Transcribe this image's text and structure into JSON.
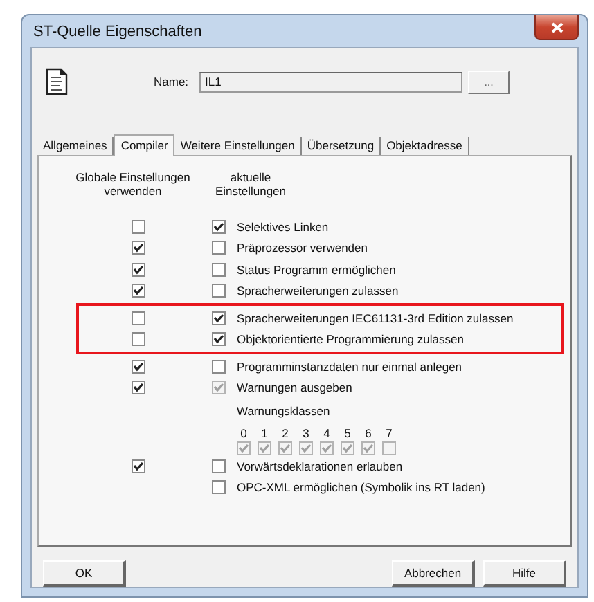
{
  "window": {
    "title": "ST-Quelle Eigenschaften"
  },
  "name_field": {
    "label": "Name:",
    "value": "IL1"
  },
  "browse_button": "...",
  "tabs": [
    {
      "label": "Allgemeines",
      "selected": false
    },
    {
      "label": "Compiler",
      "selected": true
    },
    {
      "label": "Weitere Einstellungen",
      "selected": false
    },
    {
      "label": "Übersetzung",
      "selected": false
    },
    {
      "label": "Objektadresse",
      "selected": false
    }
  ],
  "column_headers": {
    "global": "Globale Einstellungen verwenden",
    "current": "aktuelle Einstellungen"
  },
  "options": [
    {
      "kind": "option",
      "label": "Selektives Linken",
      "global": {
        "checked": false
      },
      "current": {
        "checked": true,
        "disabled": false
      },
      "highlighted": false
    },
    {
      "kind": "option",
      "label": "Präprozessor verwenden",
      "global": {
        "checked": true
      },
      "current": {
        "checked": false,
        "disabled": false
      },
      "highlighted": false
    },
    {
      "kind": "option",
      "label": "Status Programm ermöglichen",
      "global": {
        "checked": true
      },
      "current": {
        "checked": false,
        "disabled": false
      },
      "highlighted": false
    },
    {
      "kind": "option",
      "label": "Spracherweiterungen zulassen",
      "global": {
        "checked": true
      },
      "current": {
        "checked": false,
        "disabled": false
      },
      "highlighted": false
    },
    {
      "kind": "option",
      "label": "Spracherweiterungen IEC61131-3rd Edition zulassen",
      "global": {
        "checked": false
      },
      "current": {
        "checked": true,
        "disabled": false
      },
      "highlighted": true
    },
    {
      "kind": "option",
      "label": "Objektorientierte Programmierung zulassen",
      "global": {
        "checked": false
      },
      "current": {
        "checked": true,
        "disabled": false
      },
      "highlighted": true
    },
    {
      "kind": "option",
      "label": "Programminstanzdaten nur einmal anlegen",
      "global": {
        "checked": true
      },
      "current": {
        "checked": false,
        "disabled": false
      },
      "highlighted": false
    },
    {
      "kind": "option",
      "label": "Warnungen ausgeben",
      "global": {
        "checked": true
      },
      "current": {
        "checked": true,
        "disabled": true
      },
      "highlighted": false
    },
    {
      "kind": "warning_classes",
      "label": "Warnungsklassen",
      "classes": [
        {
          "label": "0",
          "checked": true,
          "disabled": true
        },
        {
          "label": "1",
          "checked": true,
          "disabled": true
        },
        {
          "label": "2",
          "checked": true,
          "disabled": true
        },
        {
          "label": "3",
          "checked": true,
          "disabled": true
        },
        {
          "label": "4",
          "checked": true,
          "disabled": true
        },
        {
          "label": "5",
          "checked": true,
          "disabled": true
        },
        {
          "label": "6",
          "checked": true,
          "disabled": true
        },
        {
          "label": "7",
          "checked": false,
          "disabled": true
        }
      ]
    },
    {
      "kind": "option",
      "label": "Vorwärtsdeklarationen erlauben",
      "global": {
        "checked": true
      },
      "current": {
        "checked": false,
        "disabled": false
      },
      "highlighted": false
    },
    {
      "kind": "option",
      "label": "OPC-XML ermöglichen (Symbolik ins RT laden)",
      "current": {
        "checked": false,
        "disabled": false
      },
      "highlighted": false
    }
  ],
  "buttons": [
    {
      "label": "OK",
      "kind": "left"
    },
    {
      "label": "Abbrechen",
      "kind": "right"
    },
    {
      "label": "Hilfe",
      "kind": "right"
    }
  ]
}
